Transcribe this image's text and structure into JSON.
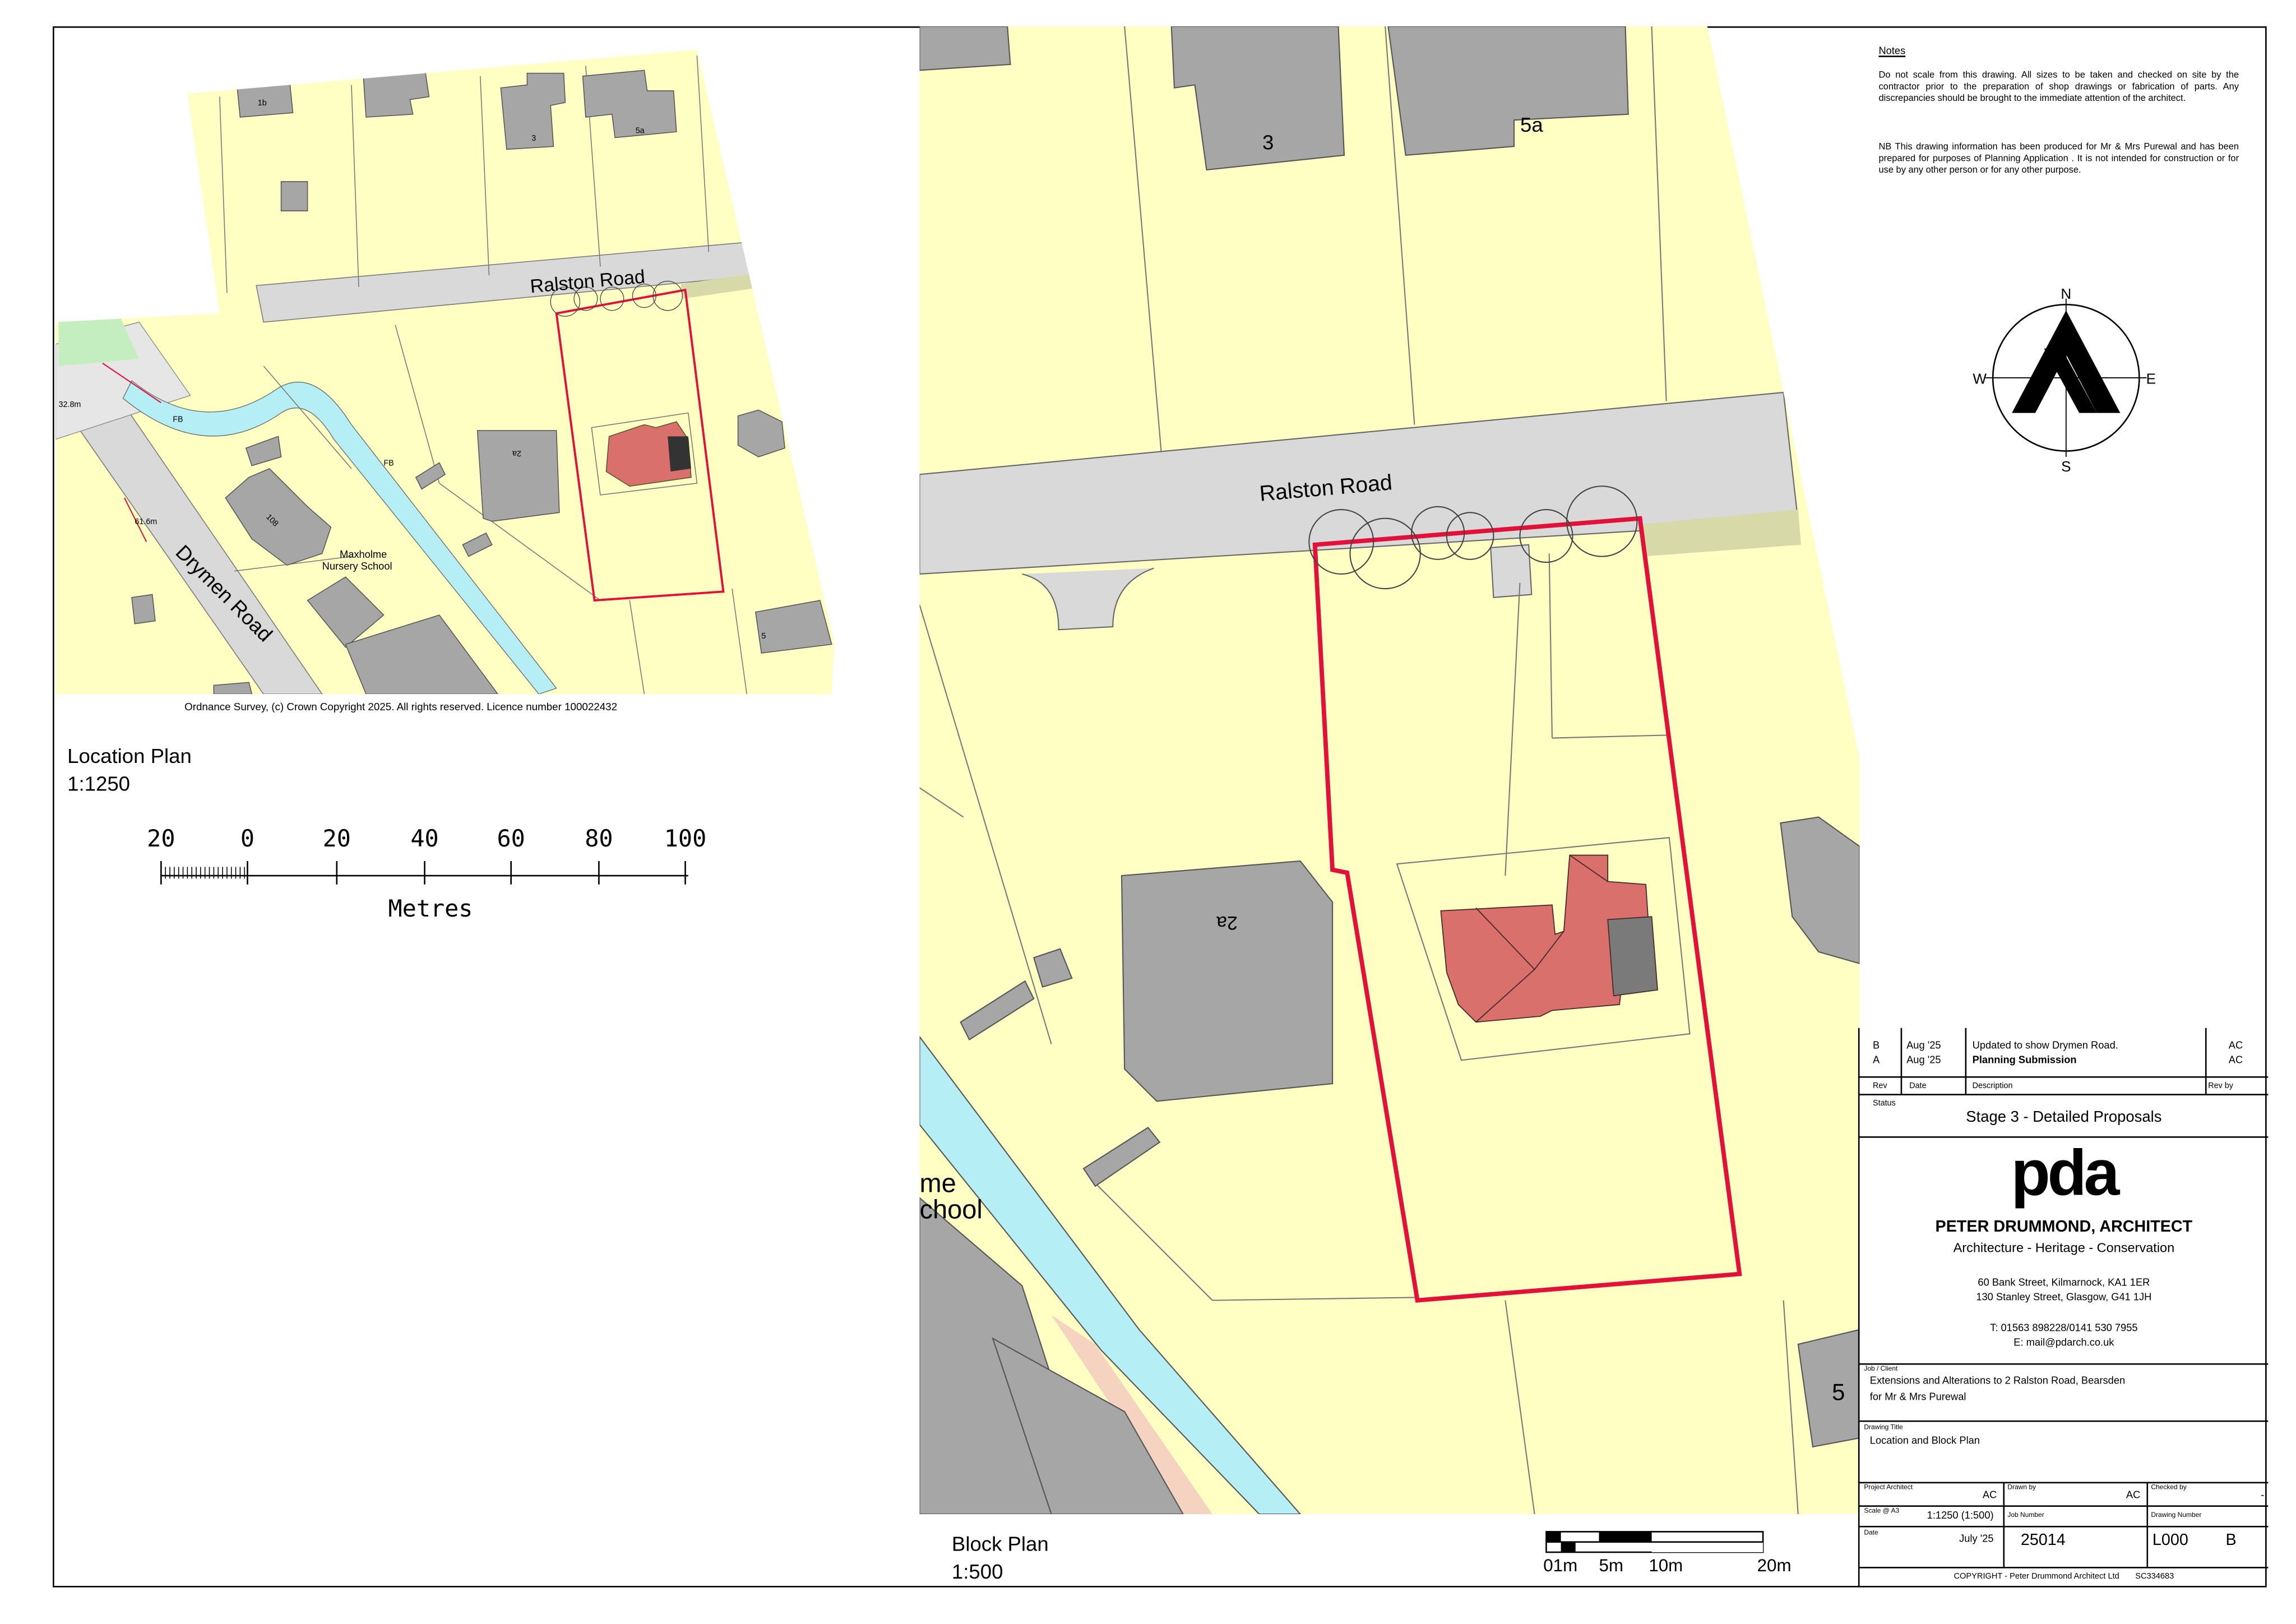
{
  "notes": {
    "heading": "Notes",
    "para1": "Do not scale from this drawing.  All sizes to be taken and checked on site by the contractor prior to the preparation of shop drawings or fabrication of parts. Any discrepancies should be brought to the immediate attention of the architect.",
    "para2": "NB This drawing information has been produced for  Mr & Mrs Purewal and has been prepared for purposes of Planning Application . It is not intended for construction or for use by any other person or for any other purpose."
  },
  "compass": {
    "n": "N",
    "s": "S",
    "e": "E",
    "w": "W"
  },
  "location_plan": {
    "title": "Location Plan",
    "scale": "1:1250",
    "copyright": "Ordnance Survey, (c) Crown Copyright 2025. All rights reserved. Licence number 100022432",
    "road_labels": [
      "Ralston Road",
      "Drymen Road"
    ],
    "map_labels": [
      "1b",
      "3",
      "5a",
      "2a",
      "5",
      "FB",
      "FB",
      "108",
      "Maxholme",
      "Nursery School",
      "32.8m",
      "61.6m"
    ],
    "scale_bar": {
      "ticks": [
        "20",
        "0",
        "20",
        "40",
        "60",
        "80",
        "100"
      ],
      "unit": "Metres"
    }
  },
  "block_plan": {
    "title": "Block Plan",
    "scale": "1:500",
    "road_label": "Ralston Road",
    "map_labels": [
      "3",
      "5a",
      "2a",
      "5",
      "me",
      "chool"
    ],
    "scale_bar": {
      "ticks": [
        "01m",
        "5m",
        "10m",
        "20m"
      ]
    }
  },
  "title_block": {
    "revisions": [
      {
        "rev": "B",
        "date": "Aug '25",
        "description": "Updated to show Drymen Road.",
        "by": "AC"
      },
      {
        "rev": "A",
        "date": "Aug '25",
        "description": "Planning Submission",
        "by": "AC"
      }
    ],
    "rev_headers": {
      "rev": "Rev",
      "date": "Date",
      "description": "Description",
      "by": "Rev by"
    },
    "status_label": "Status",
    "status": "Stage 3 - Detailed Proposals",
    "logo": "pda",
    "firm": "PETER DRUMMOND, ARCHITECT",
    "tagline": "Architecture - Heritage - Conservation",
    "address1": "60 Bank Street, Kilmarnock, KA1 1ER",
    "address2": "130 Stanley Street, Glasgow, G41 1JH",
    "phone": "T: 01563 898228/0141 530 7955",
    "email": "E: mail@pdarch.co.uk",
    "job_label": "Job / Client",
    "job_line1": "Extensions and Alterations to 2 Ralston Road, Bearsden",
    "job_line2": "for Mr & Mrs Purewal",
    "drawing_title_label": "Drawing Title",
    "drawing_title": "Location and Block Plan",
    "project_architect_label": "Project Architect",
    "project_architect": "AC",
    "drawn_by_label": "Drawn by",
    "drawn_by": "AC",
    "checked_by_label": "Checked by",
    "checked_by": "-",
    "scale_label": "Scale @ A3",
    "scale": "1:1250 (1:500)",
    "job_number_label": "Job Number",
    "job_number": "25014",
    "drawing_number_label": "Drawing Number",
    "drawing_number": "L000",
    "drawing_rev": "B",
    "date_label": "Date",
    "date": "July '25",
    "footer": "COPYRIGHT - Peter Drummond Architect Ltd       SC334683"
  },
  "colors": {
    "land": "#ffffc4",
    "road": "#d9d9d9",
    "building": "#a6a6a6",
    "water": "#b6eef5",
    "boundary": "#e3113a",
    "roof": "#d9706c"
  }
}
